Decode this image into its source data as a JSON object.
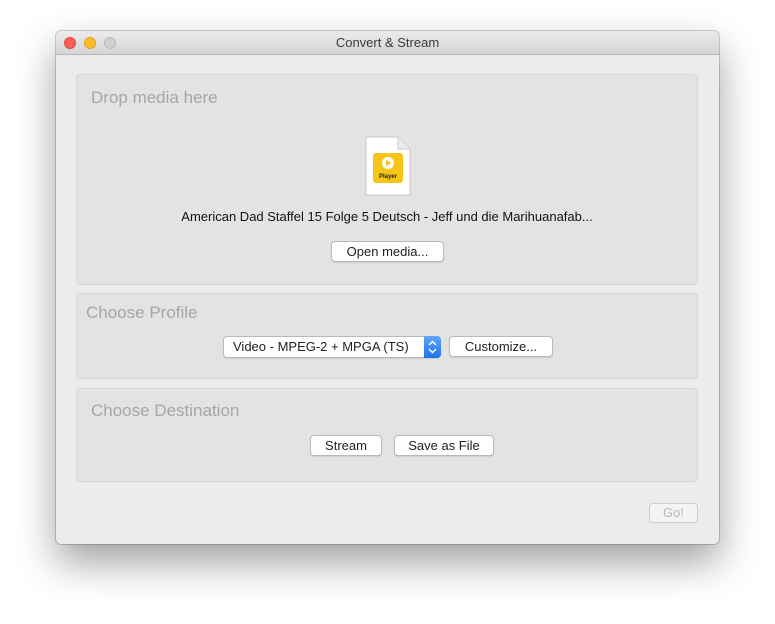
{
  "window": {
    "title": "Convert & Stream"
  },
  "drop_panel": {
    "title": "Drop media here",
    "file_icon_label": "Player",
    "filename": "American Dad Staffel 15 Folge 5 Deutsch - Jeff und die Marihuanafab...",
    "open_button": "Open media..."
  },
  "profile_panel": {
    "title": "Choose Profile",
    "selected_profile": "Video - MPEG-2 + MPGA (TS)",
    "customize_button": "Customize..."
  },
  "destination_panel": {
    "title": "Choose Destination",
    "stream_button": "Stream",
    "save_button": "Save as File"
  },
  "go_button": "Go!",
  "colors": {
    "close": "#fc5f57",
    "minimize": "#fdbc2e",
    "zoom_disabled": "#d0d0d0",
    "select_accent": "#1a73e6",
    "file_badge": "#f5c518"
  },
  "icons": {
    "file": "media-file-icon",
    "play": "play-icon",
    "stepper": "select-stepper-icon"
  }
}
